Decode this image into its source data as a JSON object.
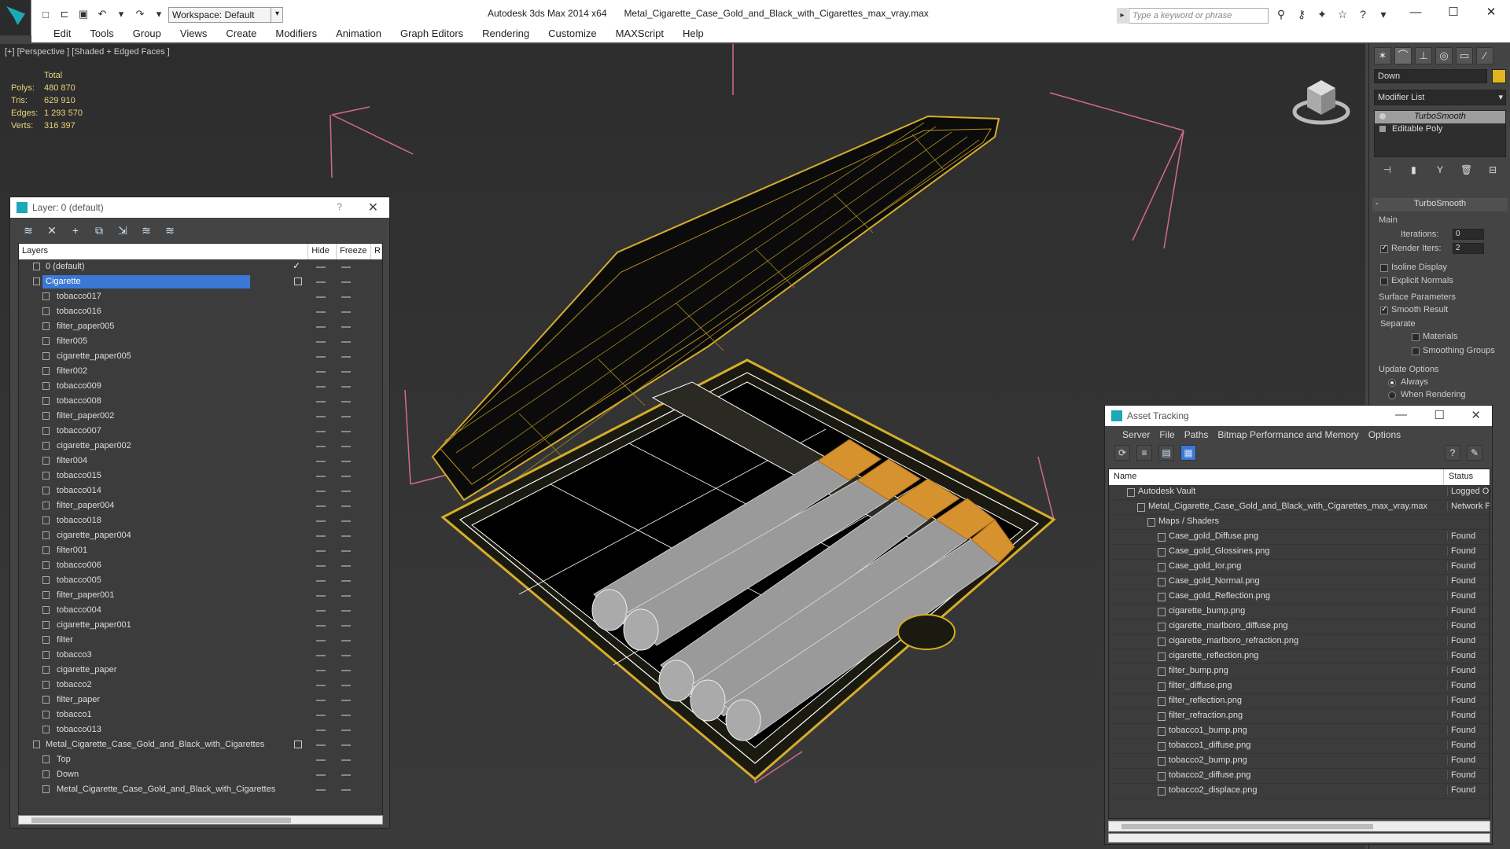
{
  "titlebar": {
    "workspace": "Workspace: Default",
    "app_name": "Autodesk 3ds Max  2014 x64",
    "file_name": "Metal_Cigarette_Case_Gold_and_Black_with_Cigarettes_max_vray.max",
    "search_placeholder": "Type a keyword or phrase"
  },
  "menu": [
    "Edit",
    "Tools",
    "Group",
    "Views",
    "Create",
    "Modifiers",
    "Animation",
    "Graph Editors",
    "Rendering",
    "Customize",
    "MAXScript",
    "Help"
  ],
  "viewport": {
    "label": "[+] [Perspective ] [Shaded + Edged Faces ]",
    "stats": {
      "header": "Total",
      "rows": [
        {
          "label": "Polys:",
          "value": "480 870"
        },
        {
          "label": "Tris:",
          "value": "629 910"
        },
        {
          "label": "Edges:",
          "value": "1 293 570"
        },
        {
          "label": "Verts:",
          "value": "316 397"
        }
      ]
    }
  },
  "command_panel": {
    "object_name": "Down",
    "object_color": "#e1b521",
    "modifier_list": "Modifier List",
    "stack": [
      {
        "label": "TurboSmooth",
        "selected": true
      },
      {
        "label": "Editable Poly",
        "selected": false
      }
    ],
    "rollout_title": "TurboSmooth",
    "main_label": "Main",
    "iterations_label": "Iterations:",
    "iterations_value": "0",
    "render_iters_label": "Render Iters:",
    "render_iters_value": "2",
    "isoline_label": "Isoline Display",
    "explicit_normals_label": "Explicit Normals",
    "surface_params_label": "Surface Parameters",
    "smooth_result_label": "Smooth Result",
    "separate_label": "Separate",
    "materials_label": "Materials",
    "smoothing_groups_label": "Smoothing Groups",
    "update_options_label": "Update Options",
    "always_label": "Always",
    "when_rendering_label": "When Rendering"
  },
  "layer_dialog": {
    "title": "Layer: 0 (default)",
    "help": "?",
    "columns": [
      "Layers",
      "Hide",
      "Freeze",
      "R"
    ],
    "rows": [
      {
        "name": "0 (default)",
        "indent": 1,
        "type": "layer",
        "current": true
      },
      {
        "name": "Cigarette",
        "indent": 1,
        "type": "layer",
        "selected": true
      },
      {
        "name": "tobacco017",
        "indent": 2,
        "type": "object"
      },
      {
        "name": "tobacco016",
        "indent": 2,
        "type": "object"
      },
      {
        "name": "filter_paper005",
        "indent": 2,
        "type": "object"
      },
      {
        "name": "filter005",
        "indent": 2,
        "type": "object"
      },
      {
        "name": "cigarette_paper005",
        "indent": 2,
        "type": "object"
      },
      {
        "name": "filter002",
        "indent": 2,
        "type": "object"
      },
      {
        "name": "tobacco009",
        "indent": 2,
        "type": "object"
      },
      {
        "name": "tobacco008",
        "indent": 2,
        "type": "object"
      },
      {
        "name": "filter_paper002",
        "indent": 2,
        "type": "object"
      },
      {
        "name": "tobacco007",
        "indent": 2,
        "type": "object"
      },
      {
        "name": "cigarette_paper002",
        "indent": 2,
        "type": "object"
      },
      {
        "name": "filter004",
        "indent": 2,
        "type": "object"
      },
      {
        "name": "tobacco015",
        "indent": 2,
        "type": "object"
      },
      {
        "name": "tobacco014",
        "indent": 2,
        "type": "object"
      },
      {
        "name": "filter_paper004",
        "indent": 2,
        "type": "object"
      },
      {
        "name": "tobacco018",
        "indent": 2,
        "type": "object"
      },
      {
        "name": "cigarette_paper004",
        "indent": 2,
        "type": "object"
      },
      {
        "name": "filter001",
        "indent": 2,
        "type": "object"
      },
      {
        "name": "tobacco006",
        "indent": 2,
        "type": "object"
      },
      {
        "name": "tobacco005",
        "indent": 2,
        "type": "object"
      },
      {
        "name": "filter_paper001",
        "indent": 2,
        "type": "object"
      },
      {
        "name": "tobacco004",
        "indent": 2,
        "type": "object"
      },
      {
        "name": "cigarette_paper001",
        "indent": 2,
        "type": "object"
      },
      {
        "name": "filter",
        "indent": 2,
        "type": "object"
      },
      {
        "name": "tobacco3",
        "indent": 2,
        "type": "object"
      },
      {
        "name": "cigarette_paper",
        "indent": 2,
        "type": "object"
      },
      {
        "name": "tobacco2",
        "indent": 2,
        "type": "object"
      },
      {
        "name": "filter_paper",
        "indent": 2,
        "type": "object"
      },
      {
        "name": "tobacco1",
        "indent": 2,
        "type": "object"
      },
      {
        "name": "tobacco013",
        "indent": 2,
        "type": "object"
      },
      {
        "name": "Metal_Cigarette_Case_Gold_and_Black_with_Cigarettes",
        "indent": 1,
        "type": "layer",
        "marker": true
      },
      {
        "name": "Top",
        "indent": 2,
        "type": "object"
      },
      {
        "name": "Down",
        "indent": 2,
        "type": "object"
      },
      {
        "name": "Metal_Cigarette_Case_Gold_and_Black_with_Cigarettes",
        "indent": 2,
        "type": "object"
      }
    ]
  },
  "asset_dialog": {
    "title": "Asset Tracking",
    "menu": [
      "Server",
      "File",
      "Paths",
      "Bitmap Performance and Memory",
      "Options"
    ],
    "columns": {
      "name": "Name",
      "status": "Status"
    },
    "rows": [
      {
        "name": "Autodesk Vault",
        "status": "Logged O",
        "indent": 1
      },
      {
        "name": "Metal_Cigarette_Case_Gold_and_Black_with_Cigarettes_max_vray.max",
        "status": "Network P",
        "indent": 2
      },
      {
        "name": "Maps / Shaders",
        "status": "",
        "indent": 3
      },
      {
        "name": "Case_gold_Diffuse.png",
        "status": "Found",
        "indent": 4
      },
      {
        "name": "Case_gold_Glossines.png",
        "status": "Found",
        "indent": 4
      },
      {
        "name": "Case_gold_Ior.png",
        "status": "Found",
        "indent": 4
      },
      {
        "name": "Case_gold_Normal.png",
        "status": "Found",
        "indent": 4
      },
      {
        "name": "Case_gold_Reflection.png",
        "status": "Found",
        "indent": 4
      },
      {
        "name": "cigarette_bump.png",
        "status": "Found",
        "indent": 4
      },
      {
        "name": "cigarette_marlboro_diffuse.png",
        "status": "Found",
        "indent": 4
      },
      {
        "name": "cigarette_marlboro_refraction.png",
        "status": "Found",
        "indent": 4
      },
      {
        "name": "cigarette_reflection.png",
        "status": "Found",
        "indent": 4
      },
      {
        "name": "filter_bump.png",
        "status": "Found",
        "indent": 4
      },
      {
        "name": "filter_diffuse.png",
        "status": "Found",
        "indent": 4
      },
      {
        "name": "filter_reflection.png",
        "status": "Found",
        "indent": 4
      },
      {
        "name": "filter_refraction.png",
        "status": "Found",
        "indent": 4
      },
      {
        "name": "tobacco1_bump.png",
        "status": "Found",
        "indent": 4
      },
      {
        "name": "tobacco1_diffuse.png",
        "status": "Found",
        "indent": 4
      },
      {
        "name": "tobacco2_bump.png",
        "status": "Found",
        "indent": 4
      },
      {
        "name": "tobacco2_diffuse.png",
        "status": "Found",
        "indent": 4
      },
      {
        "name": "tobacco2_displace.png",
        "status": "Found",
        "indent": 4
      }
    ]
  }
}
